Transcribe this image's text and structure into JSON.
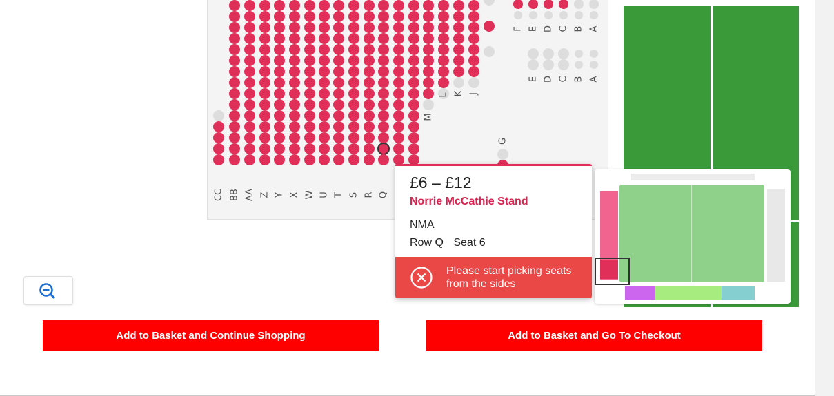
{
  "seat_map": {
    "rows_bottom": [
      "CC",
      "BB",
      "AA",
      "Z",
      "Y",
      "X",
      "W",
      "U",
      "T",
      "S",
      "R",
      "Q"
    ],
    "rows_middle": [
      "M",
      "L",
      "K",
      "J"
    ],
    "row_g": "G",
    "rows_upper_right": [
      "F",
      "E",
      "D",
      "C",
      "B",
      "A"
    ],
    "rows_lower_right": [
      "E",
      "D",
      "C",
      "B",
      "A"
    ],
    "colors": {
      "available": "#e0305a",
      "unavailable": "#dddddd"
    }
  },
  "tooltip": {
    "price": "£6 – £12",
    "stand": "Norrie McCathie Stand",
    "area": "NMA",
    "row": "Row Q",
    "seat": "Seat 6",
    "error": "Please start picking seats from the sides"
  },
  "buttons": {
    "continue": "Add to Basket and Continue Shopping",
    "checkout": "Add to Basket and Go To Checkout"
  },
  "zoom": {
    "icon": "zoom-out-icon"
  },
  "colors": {
    "button": "#ff0000",
    "pitch": "#3a9a3a",
    "accent": "#e0305a",
    "error": "#ea4747"
  }
}
